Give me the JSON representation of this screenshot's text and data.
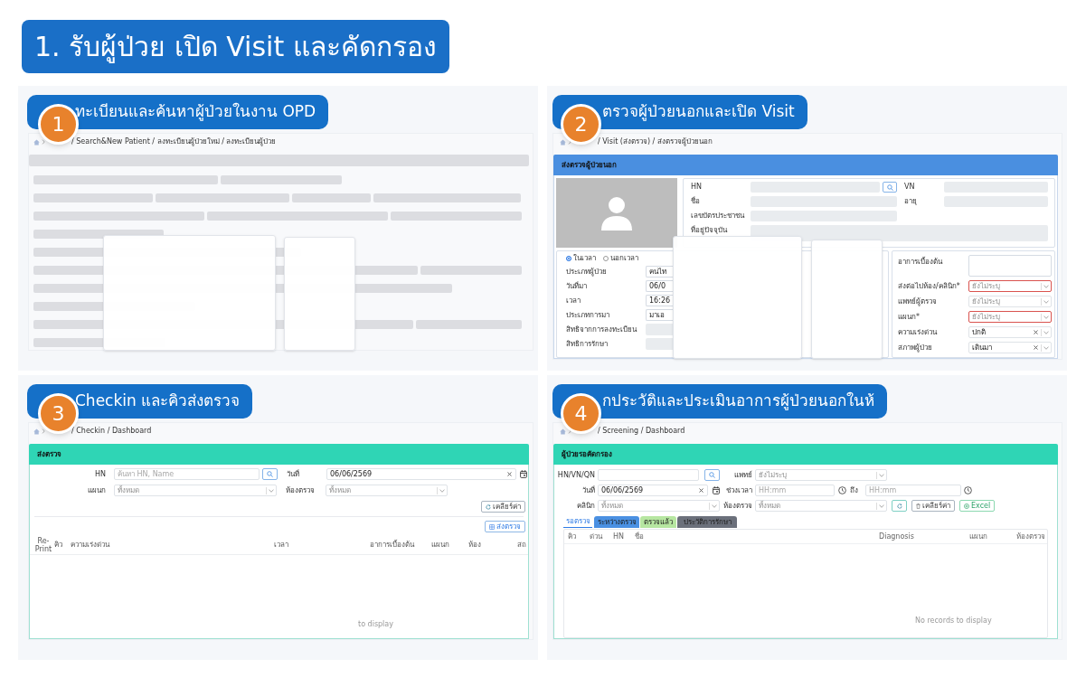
{
  "title": "1. รับผู้ป่วย เปิด Visit และคัดกรอง",
  "steps": [
    {
      "number": "1",
      "heading": "ทะเบียนและค้นหาผู้ป่วยในงาน OPD",
      "kind": "registration",
      "screen": {
        "breadcrumb": "/ Search&New Patient / ลงทะเบียนผู้ป่วยใหม่ / ลงทะเบียนผู้ป่วย"
      }
    },
    {
      "number": "2",
      "heading": "ตรวจผู้ป่วยนอกและเปิด Visit",
      "kind": "visit",
      "screen": {
        "breadcrumb": "/ Visit (ส่งตรวจ) / ส่งตรวจผู้ป่วยนอก",
        "card_title": "ส่งตรวจผู้ป่วยนอก",
        "patient": {
          "hn_label": "HN",
          "vn_label": "VN",
          "name_label": "ชื่อ",
          "age_label": "อายุ",
          "id_label": "เลขบัตรประชาชน",
          "address_label": "ที่อยู่ปัจจุบัน"
        },
        "time_options": [
          {
            "label": "ในเวลา",
            "selected": true
          },
          {
            "label": "นอกเวลา",
            "selected": false
          }
        ],
        "visit_fields": [
          {
            "label": "ประเภทผู้ป่วย",
            "kind": "input",
            "value": "คนไท"
          },
          {
            "label": "วันที่มา",
            "kind": "input",
            "value": "06/0"
          },
          {
            "label": "เวลา",
            "kind": "input",
            "value": "16:26"
          },
          {
            "label": "ประเภทการมา",
            "kind": "input",
            "value": "มาเอ"
          },
          {
            "label": "สิทธิจากการลงทะเบียน",
            "kind": "disabled"
          },
          {
            "label": "สิทธิการรักษา",
            "kind": "disabled"
          }
        ],
        "symptom_label": "อาการเบื้องต้น",
        "referral_fields": [
          {
            "label": "ส่งต่อไปห้อง/คลินิก*",
            "placeholder": "ยังไม่ระบุ",
            "error": true,
            "clearable": false
          },
          {
            "label": "แพทย์ผู้ตรวจ",
            "placeholder": "ยังไม่ระบุ",
            "error": false,
            "clearable": false
          },
          {
            "label": "แผนก*",
            "placeholder": "ยังไม่ระบุ",
            "error": true,
            "clearable": false
          },
          {
            "label": "ความเร่งด่วน",
            "value": "ปกติ",
            "error": false,
            "clearable": true
          },
          {
            "label": "สภาพผู้ป่วย",
            "value": "เดินมา",
            "error": false,
            "clearable": true
          }
        ]
      }
    },
    {
      "number": "3",
      "heading": "Checkin และคิวส่งตรวจ",
      "kind": "checkin",
      "screen": {
        "breadcrumb": "/ Checkin / Dashboard",
        "card_title": "ส่งตรวจ",
        "filter_rows": [
          [
            {
              "kind": "search",
              "label": "HN",
              "placeholder": "ค้นหา HN, Name"
            },
            {
              "kind": "date",
              "label": "วันที่",
              "value": "06/06/2569"
            }
          ],
          [
            {
              "kind": "select",
              "label": "แผนก",
              "placeholder": "ทั้งหมด"
            },
            {
              "kind": "select",
              "label": "ห้องตรวจ",
              "placeholder": "ทั้งหมด"
            }
          ]
        ],
        "buttons": [
          {
            "kind": "reset",
            "label": "เคลียร์ค่า"
          },
          {
            "kind": "send",
            "label": "ส่งตรวจ"
          }
        ],
        "columns": [
          "Re-Print",
          "คิว",
          "ความเร่งด่วน",
          "เวลา",
          "อาการเบื้องต้น",
          "แผนก",
          "ห้อง",
          "สถ"
        ],
        "empty_text": "to display"
      }
    },
    {
      "number": "4",
      "heading": "กประวัติและประเมินอาการผู้ป่วยนอกในห้",
      "kind": "screening",
      "screen": {
        "breadcrumb": "/ Screening / Dashboard",
        "card_title": "ผู้ป่วยรอคัดกรอง",
        "filter_rows": [
          [
            {
              "kind": "search",
              "label": "HN/VN/QN"
            },
            {
              "kind": "select",
              "label": "แพทย์",
              "placeholder": "ยังไม่ระบุ"
            }
          ],
          [
            {
              "kind": "date",
              "label": "วันที่",
              "value": "06/06/2569"
            },
            {
              "kind": "time",
              "label": "ช่วงเวลา",
              "placeholder": "HH:mm"
            },
            {
              "kind": "time",
              "label": "ถึง",
              "placeholder": "HH:mm"
            }
          ],
          [
            {
              "kind": "select",
              "label": "คลินิก",
              "placeholder": "ทั้งหมด"
            },
            {
              "kind": "select",
              "label": "ห้องตรวจ",
              "placeholder": "ทั้งหมด"
            }
          ]
        ],
        "buttons": [
          {
            "kind": "refresh"
          },
          {
            "kind": "clear",
            "label": "เคลียร์ค่า"
          },
          {
            "kind": "excel",
            "label": "Excel"
          }
        ],
        "tabs": [
          {
            "label": "รอตรวจ",
            "selected": true
          },
          {
            "label": "ระหว่างตรวจ",
            "selected": false,
            "color": "#4a90e2"
          },
          {
            "label": "ตรวจแล้ว",
            "selected": false,
            "color": "#b6e6a1"
          },
          {
            "label": "ประวัติการรักษา",
            "selected": false,
            "color": "#6b707b"
          }
        ],
        "columns": [
          "คิว",
          "ด่วน",
          "HN",
          "ชื่อ",
          "Diagnosis",
          "แผนก",
          "ห้องตรวจ"
        ],
        "empty_text": "No records to display"
      }
    }
  ]
}
